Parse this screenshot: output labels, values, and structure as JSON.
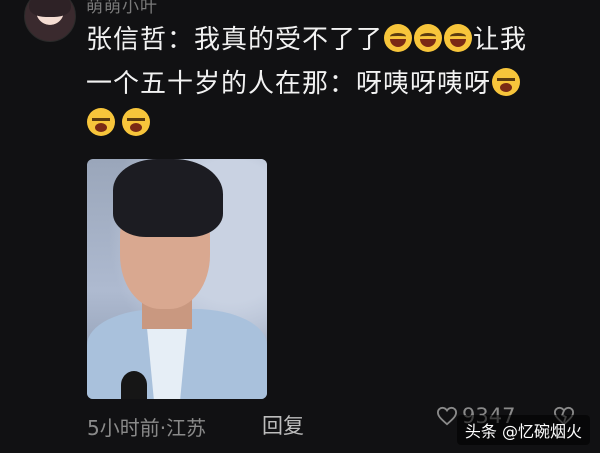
{
  "comment": {
    "username": "萌萌小叶",
    "line1_prefix": "张信哲：我真的受不了了",
    "line1_suffix": "让我",
    "line2": "一个五十岁的人在那：呀咦呀咦呀",
    "emojis": [
      "laugh-emoji",
      "laugh-emoji",
      "laugh-emoji",
      "cry-emoji",
      "cry-emoji",
      "cry-emoji"
    ]
  },
  "meta": {
    "time_location": "5小时前·江苏",
    "reply_label": "回复",
    "like_count": "9347"
  },
  "watermark": "头条 @忆碗烟火",
  "colors": {
    "background": "#111113",
    "text": "#f2f2f2",
    "meta": "#8a8a8a"
  }
}
